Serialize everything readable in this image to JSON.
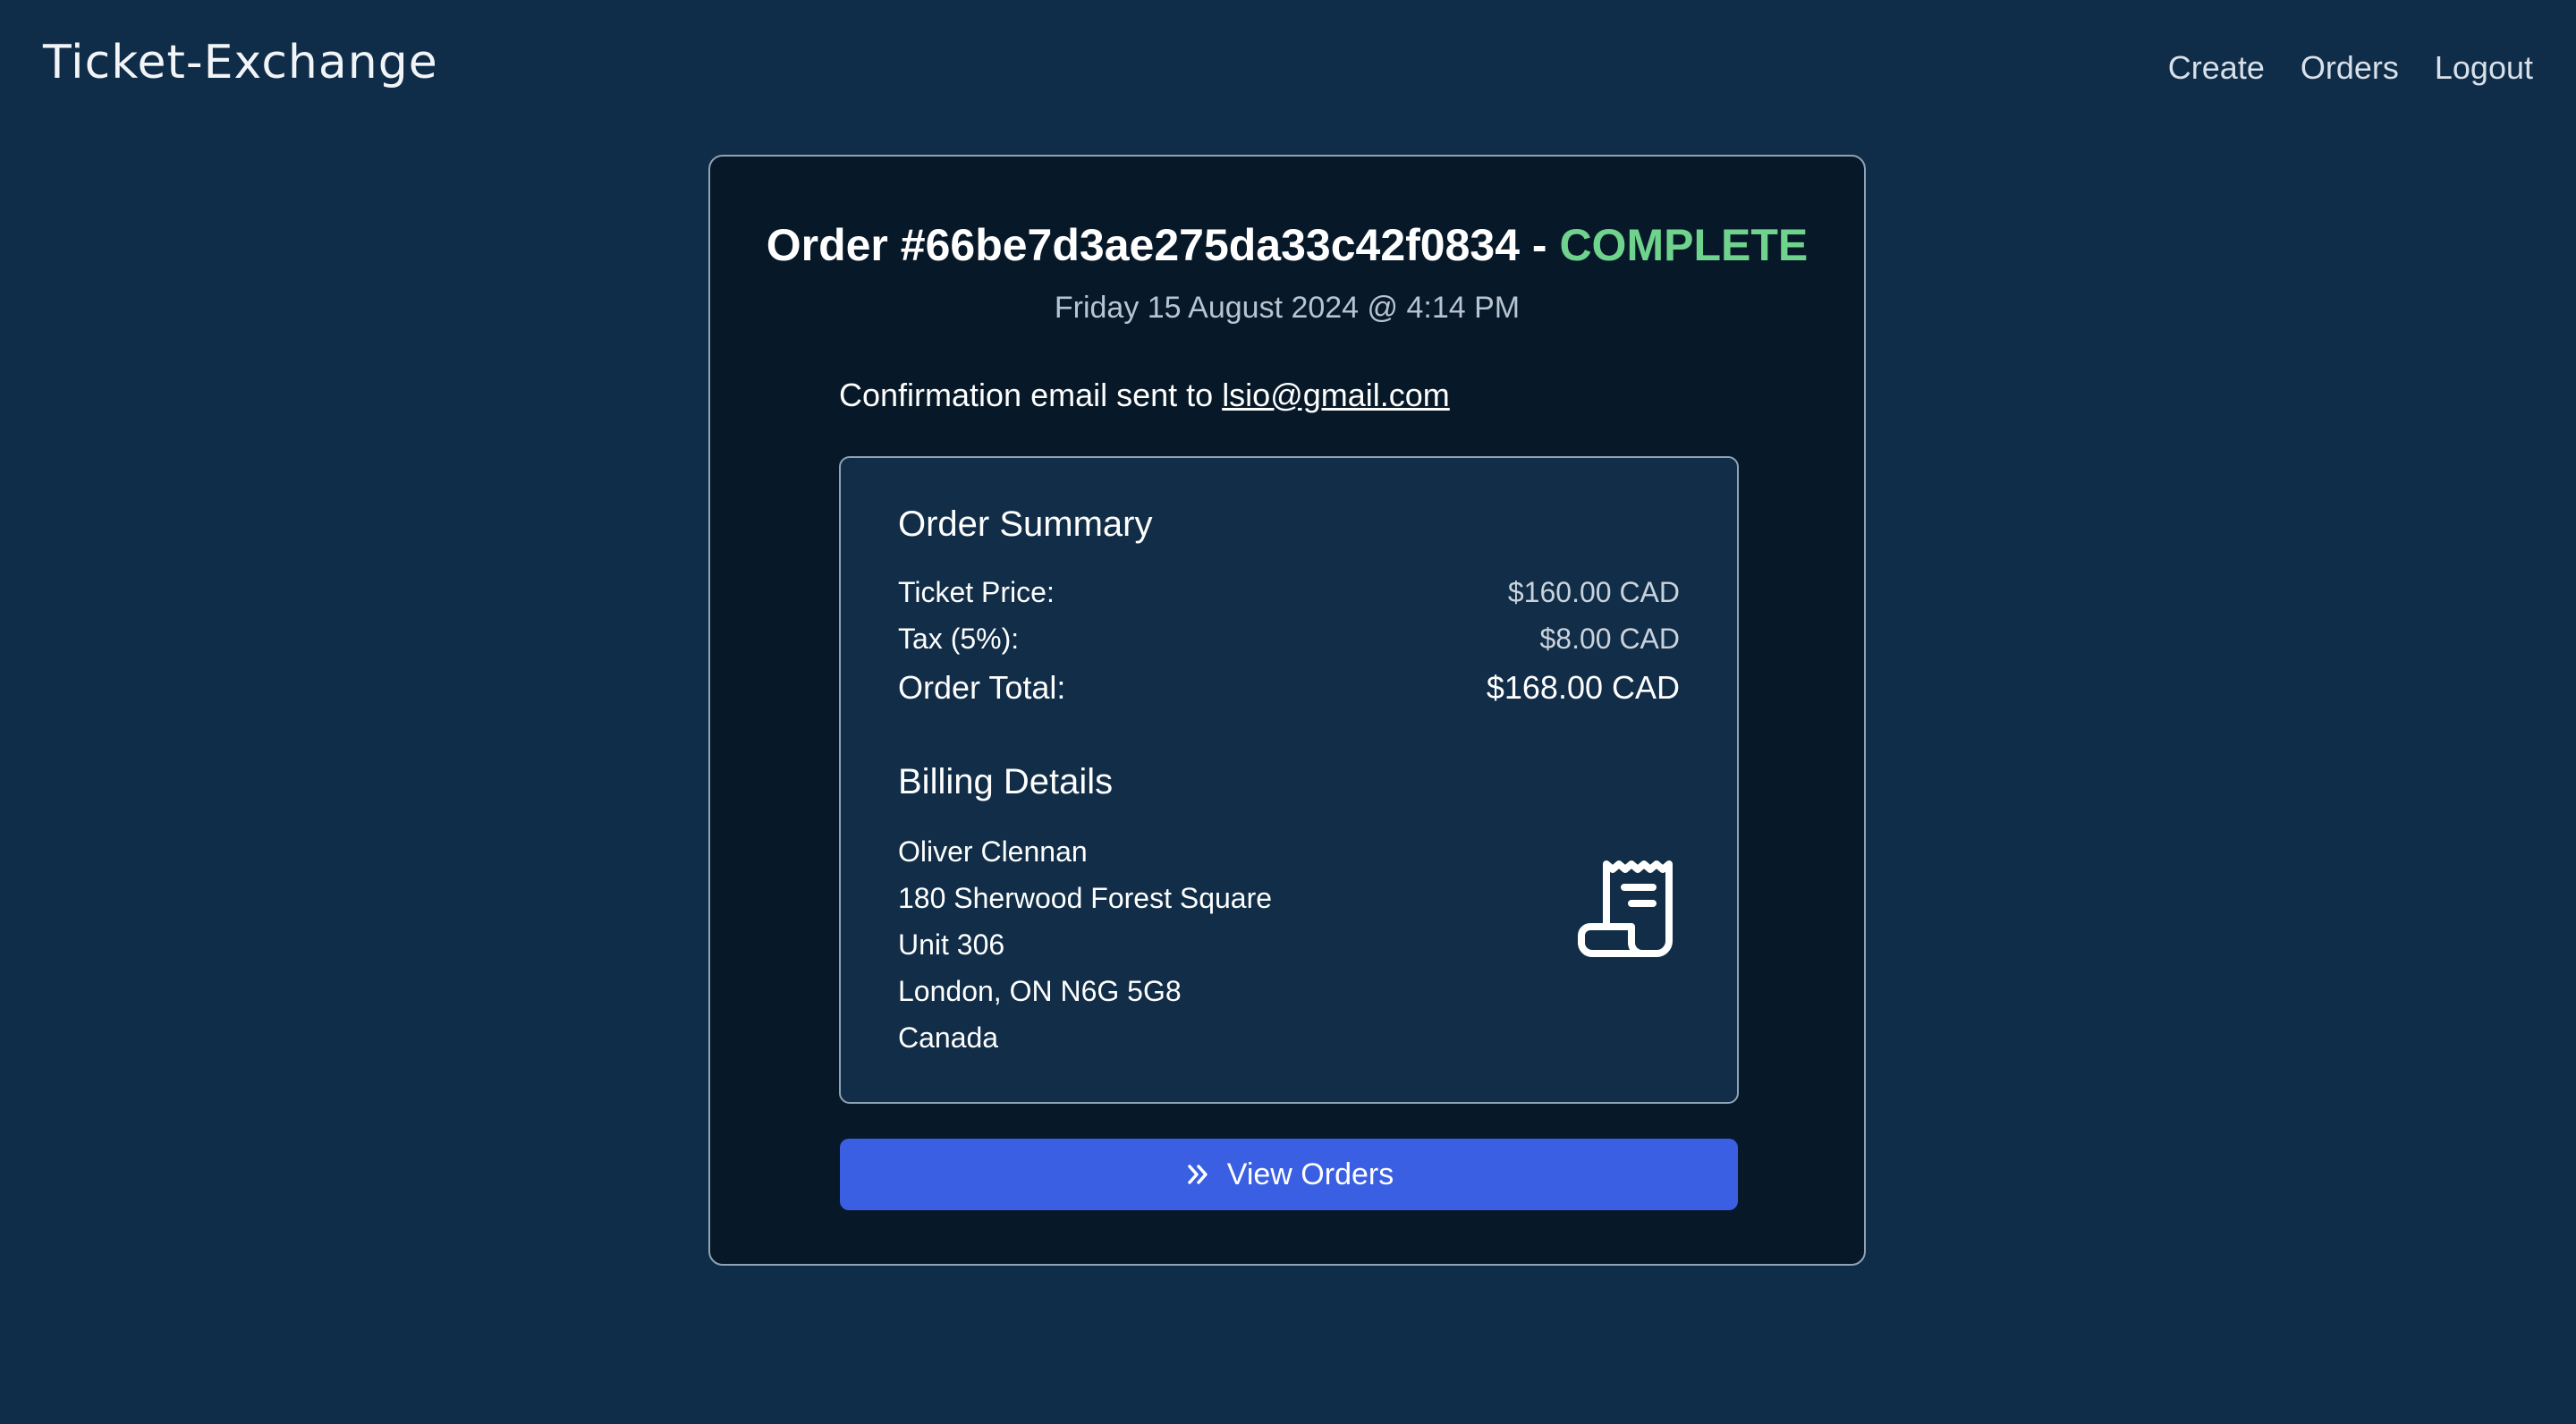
{
  "navbar": {
    "brand": "Ticket-Exchange",
    "links": [
      "Create",
      "Orders",
      "Logout"
    ]
  },
  "order": {
    "title_prefix": "Order #66be7d3ae275da33c42f0834 - ",
    "status": "COMPLETE",
    "date": "Friday 15 August 2024 @ 4:14 PM",
    "confirmation_text": "Confirmation email sent to ",
    "email": "lsio@gmail.com"
  },
  "summary": {
    "title": "Order Summary",
    "ticket_price_label": "Ticket Price:",
    "ticket_price_value": "$160.00 CAD",
    "tax_label": "Tax (5%):",
    "tax_value": "$8.00 CAD",
    "total_label": "Order Total:",
    "total_value": "$168.00 CAD"
  },
  "billing": {
    "title": "Billing Details",
    "lines": [
      "Oliver Clennan",
      "180 Sherwood Forest Square",
      "Unit 306",
      "London, ON N6G 5G8",
      "Canada"
    ],
    "icon": "receipt-icon"
  },
  "actions": {
    "view_orders_label": "View Orders",
    "view_orders_icon": "chevrons-right-icon"
  },
  "colors": {
    "background": "#0f2d48",
    "card": "#071828",
    "panel": "#112d47",
    "status_complete": "#6fd38d",
    "primary_button": "#3a5fe3"
  }
}
